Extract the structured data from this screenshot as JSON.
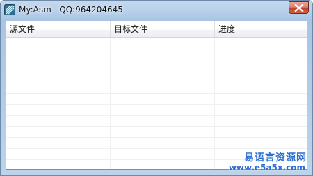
{
  "window": {
    "title": "My:Asm   QQ:964204645",
    "icon": "app-icon",
    "close_icon": "close-icon"
  },
  "table": {
    "columns": [
      "源文件",
      "目标文件",
      "进度",
      ""
    ],
    "rows": []
  },
  "watermark": {
    "logo_text": "易语言资源网",
    "url": "www.e5a5x.com",
    "color": "#2a6fd0"
  }
}
